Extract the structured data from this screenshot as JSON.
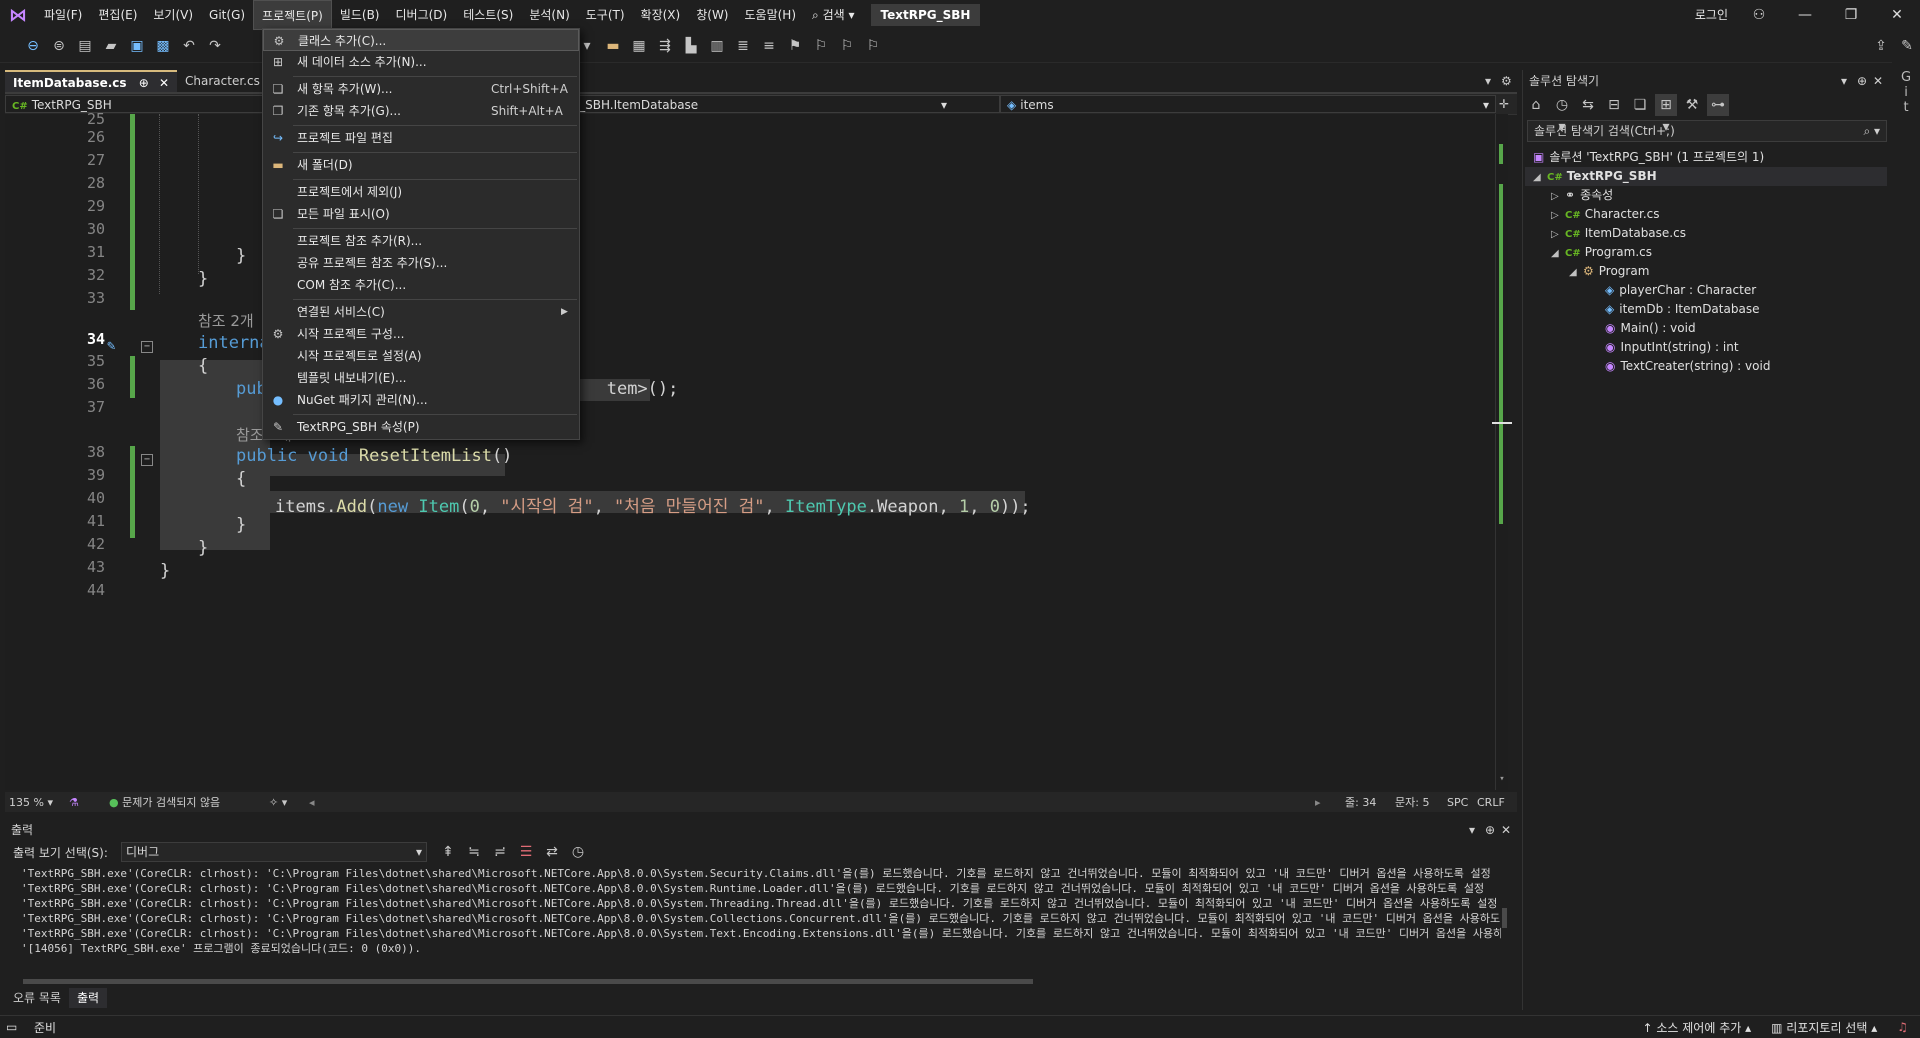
{
  "menubar": {
    "items": [
      "파일(F)",
      "편집(E)",
      "보기(V)",
      "Git(G)",
      "프로젝트(P)",
      "빌드(B)",
      "디버그(D)",
      "테스트(S)",
      "분석(N)",
      "도구(T)",
      "확장(X)",
      "창(W)",
      "도움말(H)"
    ],
    "search_label": "검색",
    "solution_name": "TextRPG_SBH",
    "login_label": "로그인"
  },
  "tabs": {
    "active": "ItemDatabase.cs",
    "pin": "⊕",
    "other": "Character.cs"
  },
  "navbar": {
    "project": "TextRPG_SBH",
    "class": "TextRPG_SBH.ItemDatabase",
    "member": "items"
  },
  "editor": {
    "lines": [
      "25",
      "26",
      "27",
      "28",
      "29",
      "30",
      "31",
      "32",
      "33",
      "34",
      "35",
      "36",
      "37",
      "38",
      "39",
      "40",
      "41",
      "42",
      "43",
      "44"
    ],
    "current_line": "34",
    "code": {
      "l31": "}",
      "l32": "}",
      "hint1": "참조 2개",
      "l34": "internal",
      "l35": "{",
      "l36_kw": "pub",
      "l36_rest": "tem>();",
      "hint2": "참조 1개",
      "l38_kw1": "public",
      "l38_kw2": "void",
      "l38_fn": "ResetItemList",
      "l38_end": "()",
      "l39": "{",
      "l40_obj": "items.",
      "l40_fn": "Add",
      "l40_p1": "(",
      "l40_new": "new",
      "l40_ty": "Item",
      "l40_p2": "(",
      "l40_n0": "0",
      "l40_c1": ", ",
      "l40_s1": "\"시작의 검\"",
      "l40_c2": ", ",
      "l40_s2": "\"처음 만들어진 검\"",
      "l40_c3": ", ",
      "l40_enum": "ItemType",
      "l40_dot": ".Weapon, ",
      "l40_n1": "1",
      "l40_c4": ", ",
      "l40_n2": "0",
      "l40_end": "));",
      "l41": "}",
      "l42": "}",
      "l43": "}"
    }
  },
  "edstatus": {
    "zoom": "135 %",
    "issues": "문제가 검색되지 않음",
    "line": "줄: 34",
    "col": "문자: 5",
    "spc": "SPC",
    "crlf": "CRLF"
  },
  "output": {
    "title": "출력",
    "select_label": "출력 보기 선택(S):",
    "select_value": "디버그",
    "lines": [
      "'TextRPG_SBH.exe'(CoreCLR: clrhost): 'C:\\Program Files\\dotnet\\shared\\Microsoft.NETCore.App\\8.0.0\\System.Security.Claims.dll'을(를) 로드했습니다. 기호를 로드하지 않고 건너뛰었습니다. 모듈이 최적화되어 있고 '내 코드만' 디버거 옵션을 사용하도록 설정",
      "'TextRPG_SBH.exe'(CoreCLR: clrhost): 'C:\\Program Files\\dotnet\\shared\\Microsoft.NETCore.App\\8.0.0\\System.Runtime.Loader.dll'을(를) 로드했습니다. 기호를 로드하지 않고 건너뛰었습니다. 모듈이 최적화되어 있고 '내 코드만' 디버거 옵션을 사용하도록 설정",
      "'TextRPG_SBH.exe'(CoreCLR: clrhost): 'C:\\Program Files\\dotnet\\shared\\Microsoft.NETCore.App\\8.0.0\\System.Threading.Thread.dll'을(를) 로드했습니다. 기호를 로드하지 않고 건너뛰었습니다. 모듈이 최적화되어 있고 '내 코드만' 디버거 옵션을 사용하도록 설정",
      "'TextRPG_SBH.exe'(CoreCLR: clrhost): 'C:\\Program Files\\dotnet\\shared\\Microsoft.NETCore.App\\8.0.0\\System.Collections.Concurrent.dll'을(를) 로드했습니다. 기호를 로드하지 않고 건너뛰었습니다. 모듈이 최적화되어 있고 '내 코드만' 디버거 옵션을 사용하도",
      "'TextRPG_SBH.exe'(CoreCLR: clrhost): 'C:\\Program Files\\dotnet\\shared\\Microsoft.NETCore.App\\8.0.0\\System.Text.Encoding.Extensions.dll'을(를) 로드했습니다. 기호를 로드하지 않고 건너뛰었습니다. 모듈이 최적화되어 있고 '내 코드만' 디버거 옵션을 사용하",
      "'[14056] TextRPG_SBH.exe' 프로그램이 종료되었습니다(코드: 0 (0x0))."
    ],
    "tab_errors": "오류 목록",
    "tab_output": "출력"
  },
  "statusbar": {
    "ready": "준비",
    "source_control": "소스 제어에 추가",
    "repo": "리포지토리 선택"
  },
  "solution_explorer": {
    "title": "솔루션 탐색기",
    "search": "솔루션 탐색기 검색(Ctrl+;)",
    "solution": "솔루션 'TextRPG_SBH' (1 프로젝트의 1)",
    "project": "TextRPG_SBH",
    "deps": "종속성",
    "file1": "Character.cs",
    "file2": "ItemDatabase.cs",
    "file3": "Program.cs",
    "class": "Program",
    "m1": "playerChar : Character",
    "m2": "itemDb : ItemDatabase",
    "m3": "Main() : void",
    "m4": "InputInt(string) : int",
    "m5": "TextCreater(string) : void"
  },
  "project_menu": {
    "items": [
      {
        "label": "클래스 추가(C)...",
        "shortcut": ""
      },
      {
        "label": "새 데이터 소스 추가(N)...",
        "shortcut": ""
      },
      {
        "label": "새 항목 추가(W)...",
        "shortcut": "Ctrl+Shift+A"
      },
      {
        "label": "기존 항목 추가(G)...",
        "shortcut": "Shift+Alt+A"
      },
      {
        "label": "프로젝트 파일 편집",
        "shortcut": ""
      },
      {
        "label": "새 폴더(D)",
        "shortcut": ""
      },
      {
        "label": "프로젝트에서 제외(J)",
        "shortcut": ""
      },
      {
        "label": "모든 파일 표시(O)",
        "shortcut": ""
      },
      {
        "label": "프로젝트 참조 추가(R)...",
        "shortcut": ""
      },
      {
        "label": "공유 프로젝트 참조 추가(S)...",
        "shortcut": ""
      },
      {
        "label": "COM 참조 추가(C)...",
        "shortcut": ""
      },
      {
        "label": "연결된 서비스(C)",
        "shortcut": ""
      },
      {
        "label": "시작 프로젝트 구성...",
        "shortcut": ""
      },
      {
        "label": "시작 프로젝트로 설정(A)",
        "shortcut": ""
      },
      {
        "label": "템플릿 내보내기(E)...",
        "shortcut": ""
      },
      {
        "label": "NuGet 패키지 관리(N)...",
        "shortcut": ""
      },
      {
        "label": "TextRPG_SBH 속성(P)",
        "shortcut": ""
      }
    ]
  },
  "colors": {
    "accent": "#007acc",
    "change_bar": "#57a64a",
    "keyword": "#569cd6",
    "type": "#4ec9b0",
    "string": "#d69d85"
  }
}
